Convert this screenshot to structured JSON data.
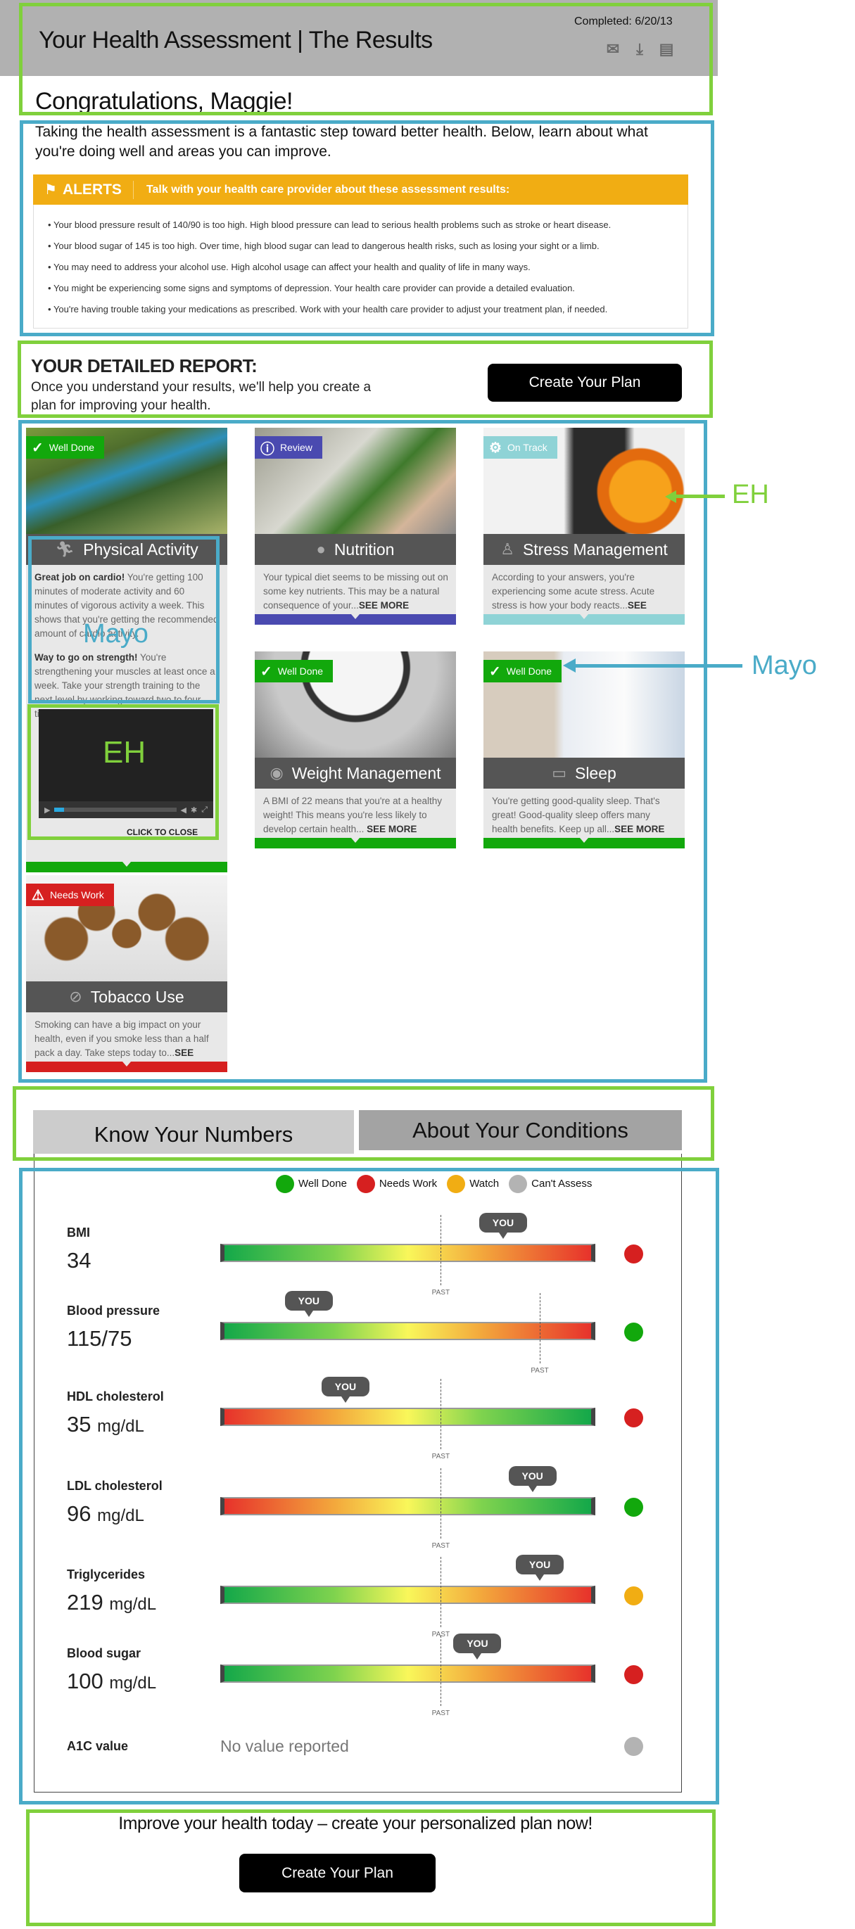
{
  "header": {
    "title": "Your Health Assessment | The Results",
    "completed": "Completed: 6/20/13",
    "icons": [
      "email-icon",
      "download-icon",
      "print-icon"
    ]
  },
  "greeting": "Congratulations, Maggie!",
  "intro": "Taking the health assessment is a fantastic step toward better health. Below, learn about what you're doing well and areas you can improve.",
  "alerts": {
    "label": "ALERTS",
    "message": "Talk with your health care provider about these assessment results:",
    "color": "#f1ad13",
    "items": [
      "Your blood pressure result of 140/90 is too high. High blood pressure can lead to serious health problems such as stroke or heart disease.",
      "Your blood sugar of 145 is too high. Over time, high blood sugar can lead to dangerous health risks, such as losing your sight or a limb.",
      "You may need to address your alcohol use. High alcohol usage can affect your health and quality of life in many ways.",
      "You might be experiencing some signs and symptoms of depression. Your health care provider can provide a detailed evaluation.",
      "You're having trouble taking your medications as prescribed. Work with your health care provider to adjust your treatment plan, if needed."
    ]
  },
  "report": {
    "title": "YOUR DETAILED REPORT:",
    "subtitle": "Once you understand your results, we'll help you create a plan for improving your health.",
    "button": "Create Your Plan"
  },
  "cards": [
    {
      "title": "Physical Activity",
      "icon": "runner-icon",
      "badge": "Well Done",
      "badge_icon": "checkmark-icon",
      "color": "#12a80c",
      "paragraphs": [
        {
          "bold": "Great job on cardio!",
          "text": " You're getting 100 minutes of moderate activity and 60 minutes of vigorous activity a week. This shows that you're getting the recommended amount of cardio activity."
        },
        {
          "bold": "Way to go on strength!",
          "text": " You're strengthening your muscles at least once a week. Take your strength training to the next level by working toward two to four times a week."
        }
      ],
      "video": {
        "close_label": "CLICK TO CLOSE",
        "progress": 0.08
      }
    },
    {
      "title": "Nutrition",
      "icon": "apple-icon",
      "badge": "Review",
      "badge_icon": "info-icon",
      "color": "#4a4ab0",
      "text": "Your typical diet seems to be missing out on some key nutrients. This may be a natural consequence of your...",
      "more": "SEE MORE"
    },
    {
      "title": "Stress Management",
      "icon": "meditation-icon",
      "badge": "On Track",
      "badge_icon": "gear-icon",
      "color": "#8fd3d6",
      "text": "According to your answers, you're experiencing some acute stress. Acute stress is how your body reacts...",
      "more": "SEE MORE"
    },
    {
      "title": "Weight Management",
      "icon": "scale-icon",
      "badge": "Well Done",
      "badge_icon": "checkmark-icon",
      "color": "#12a80c",
      "text": "A BMI of 22 means that you're at a healthy weight! This means you're less likely to develop certain health... ",
      "more": "SEE MORE"
    },
    {
      "title": "Sleep",
      "icon": "bed-icon",
      "badge": "Well Done",
      "badge_icon": "checkmark-icon",
      "color": "#12a80c",
      "text": "You're getting good-quality sleep. That's great! Good-quality sleep offers many health benefits. Keep up all...",
      "more": "SEE MORE"
    },
    {
      "title": "Tobacco Use",
      "icon": "no-smoking-icon",
      "badge": "Needs Work",
      "badge_icon": "warning-icon",
      "color": "#d62020",
      "text": "Smoking can have a big impact on your health, even if you smoke less than a half pack a day. Take steps today to...",
      "more": "SEE MORE"
    }
  ],
  "tabs": [
    "Know Your Numbers",
    "About Your Conditions"
  ],
  "legend": [
    {
      "label": "Well Done",
      "color": "#12a80c"
    },
    {
      "label": "Needs Work",
      "color": "#d62020"
    },
    {
      "label": "Watch",
      "color": "#f1ad13"
    },
    {
      "label": "Can't Assess",
      "color": "#b3b3b3"
    }
  ],
  "you_label": "YOU",
  "past_label": "PAST",
  "metrics": [
    {
      "label": "BMI",
      "value": "34",
      "unit": "",
      "direction": "green-to-red",
      "you": 0.76,
      "past": 0.59,
      "status": "Needs Work"
    },
    {
      "label": "Blood pressure",
      "value": "115/75",
      "unit": "",
      "direction": "green-to-red",
      "you": 0.23,
      "past": 0.86,
      "status": "Well Done"
    },
    {
      "label": "HDL cholesterol",
      "value": "35",
      "unit": "mg/dL",
      "direction": "red-to-green",
      "you": 0.33,
      "past": 0.59,
      "status": "Needs Work"
    },
    {
      "label": "LDL cholesterol",
      "value": "96",
      "unit": "mg/dL",
      "direction": "red-to-green",
      "you": 0.84,
      "past": 0.59,
      "status": "Well Done"
    },
    {
      "label": "Triglycerides",
      "value": "219",
      "unit": "mg/dL",
      "direction": "green-to-red",
      "you": 0.86,
      "past": 0.59,
      "status": "Watch"
    },
    {
      "label": "Blood sugar",
      "value": "100",
      "unit": "mg/dL",
      "direction": "green-to-red",
      "you": 0.69,
      "past": 0.59,
      "status": "Needs Work"
    },
    {
      "label": "A1C value",
      "no_value": "No value reported",
      "status": "Can't Assess"
    }
  ],
  "cta": {
    "text": "Improve your health today – create your personalized plan now!",
    "button": "Create Your Plan"
  },
  "annotations": {
    "eh": "EH",
    "mayo": "Mayo",
    "green": "#80d03c",
    "blue": "#4aabc8"
  }
}
